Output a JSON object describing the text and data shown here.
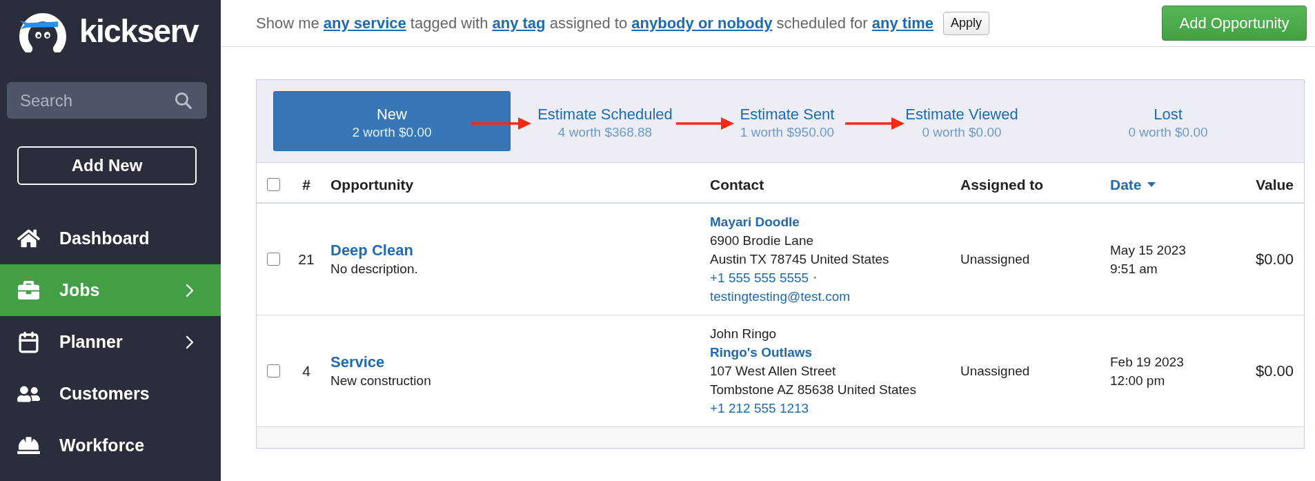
{
  "sidebar": {
    "logo": {
      "text": "kickserv"
    },
    "search": {
      "placeholder": "Search"
    },
    "add_button": {
      "label": "Add New"
    },
    "nav_items": [
      {
        "label": "Dashboard",
        "selected": false,
        "has_submenu": false
      },
      {
        "label": "Jobs",
        "selected": true,
        "has_submenu": true
      },
      {
        "label": "Planner",
        "selected": false,
        "has_submenu": true
      },
      {
        "label": "Customers",
        "selected": false,
        "has_submenu": false
      },
      {
        "label": "Workforce",
        "selected": false,
        "has_submenu": false
      }
    ]
  },
  "filter_bar": {
    "parts": [
      {
        "kind": "text",
        "text": "Show me"
      },
      {
        "kind": "link",
        "text": "any service"
      },
      {
        "kind": "text",
        "text": "tagged with"
      },
      {
        "kind": "link",
        "text": "any tag"
      },
      {
        "kind": "text",
        "text": "assigned to"
      },
      {
        "kind": "link",
        "text": "anybody or nobody"
      },
      {
        "kind": "text",
        "text": "scheduled for"
      },
      {
        "kind": "link",
        "text": "any time"
      }
    ],
    "apply_button": {
      "label": "Apply"
    }
  },
  "add_opportunity_button": {
    "label": "Add Opportunity"
  },
  "pipeline": {
    "stages": [
      {
        "name": "New",
        "summary": "2 worth $0.00",
        "selected": true
      },
      {
        "name": "Estimate Scheduled",
        "summary": "4 worth $368.88",
        "selected": false
      },
      {
        "name": "Estimate Sent",
        "summary": "1 worth $950.00",
        "selected": false
      },
      {
        "name": "Estimate Viewed",
        "summary": "0 worth $0.00",
        "selected": false
      },
      {
        "name": "Lost",
        "summary": "0 worth $0.00",
        "selected": false
      }
    ]
  },
  "table": {
    "header_checkbox": {
      "checked": false
    },
    "columns": [
      {
        "label": "#",
        "sorted": false
      },
      {
        "label": "Opportunity",
        "sorted": false
      },
      {
        "label": "Contact",
        "sorted": false
      },
      {
        "label": "Assigned to",
        "sorted": false
      },
      {
        "label": "Date",
        "sorted": true
      },
      {
        "label": "Value",
        "sorted": false
      }
    ],
    "rows": [
      {
        "checked": false,
        "number": "21",
        "title": "Deep Clean",
        "description": "No description.",
        "contact": [
          {
            "kind": "name",
            "text": "Mayari Doodle"
          },
          {
            "kind": "text",
            "text": "6900 Brodie Lane"
          },
          {
            "kind": "text",
            "text": "Austin TX 78745 United States"
          },
          {
            "kind": "link",
            "text": "+1 555 555 5555",
            "separator": "•"
          },
          {
            "kind": "link",
            "text": "testingtesting@test.com"
          }
        ],
        "assigned_to": "Unassigned",
        "date": "May 15 2023",
        "time": "9:51 am",
        "value": "$0.00"
      },
      {
        "checked": false,
        "number": "4",
        "title": "Service",
        "description": "New construction",
        "contact": [
          {
            "kind": "text",
            "text": "John Ringo"
          },
          {
            "kind": "name",
            "text": "Ringo's Outlaws"
          },
          {
            "kind": "text",
            "text": "107 West Allen Street"
          },
          {
            "kind": "text",
            "text": "Tombstone AZ 85638 United States"
          },
          {
            "kind": "link",
            "text": "+1 212 555 1213"
          }
        ],
        "assigned_to": "Unassigned",
        "date": "Feb 19 2023",
        "time": "12:00 pm",
        "value": "$0.00"
      }
    ]
  }
}
